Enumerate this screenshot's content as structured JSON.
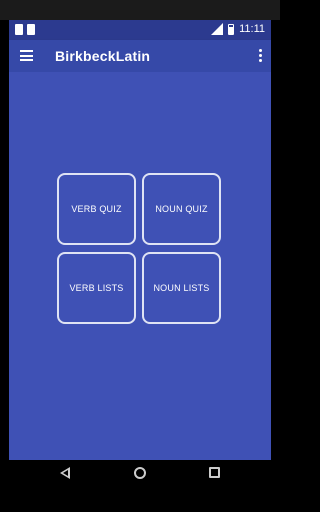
{
  "status_bar": {
    "time": "11:11",
    "icons": [
      "notification-icon",
      "sd-card-icon",
      "signal-icon",
      "battery-icon"
    ]
  },
  "app_bar": {
    "title": "BirkbeckLatin",
    "menu_icon": "hamburger-menu-icon",
    "overflow_icon": "more-vert-icon"
  },
  "menu": {
    "verb_quiz": "VERB QUIZ",
    "noun_quiz": "NOUN QUIZ",
    "verb_lists": "VERB LISTS",
    "noun_lists": "NOUN LISTS"
  },
  "nav_bar": {
    "icons": [
      "back-icon",
      "home-icon",
      "recents-icon"
    ]
  },
  "colors": {
    "primary": "#3f51b5",
    "primary_dark": "#2c3a8f",
    "app_bar": "#3649a8",
    "tile_border": "#dfe3f4"
  }
}
